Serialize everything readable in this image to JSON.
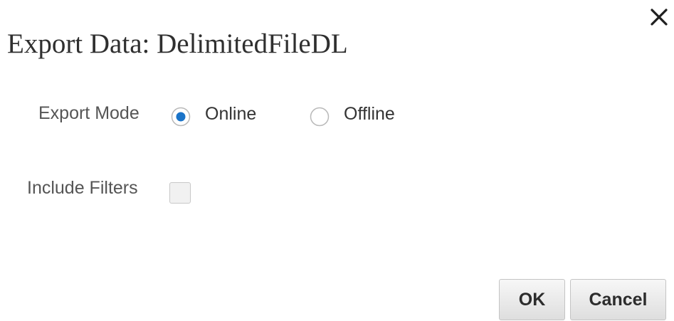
{
  "dialog": {
    "title": "Export Data: DelimitedFileDL",
    "close_icon": "close-icon"
  },
  "export_mode": {
    "label": "Export Mode",
    "options": [
      {
        "label": "Online",
        "selected": true
      },
      {
        "label": "Offline",
        "selected": false
      }
    ]
  },
  "include_filters": {
    "label": "Include Filters",
    "checked": false
  },
  "buttons": {
    "ok_label": "OK",
    "cancel_label": "Cancel"
  },
  "colors": {
    "radio_selected": "#1a73c8",
    "radio_border": "#b9b9b9"
  }
}
